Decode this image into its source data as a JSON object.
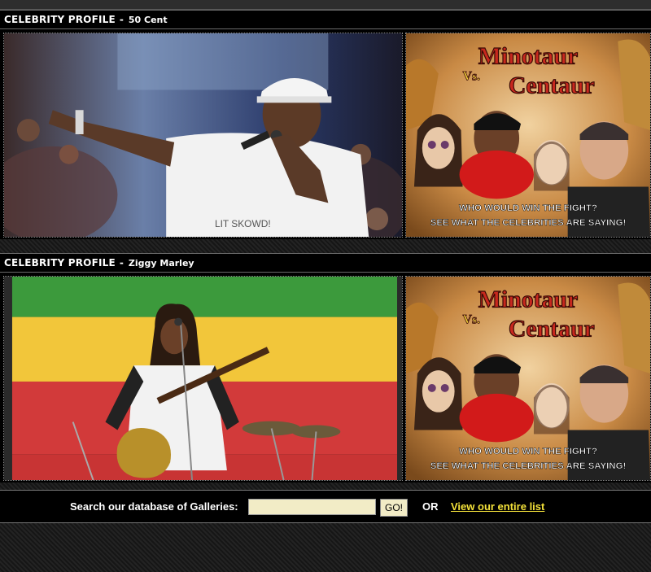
{
  "sections": [
    {
      "header": {
        "label": "CELEBRITY PROFILE",
        "separator": "-",
        "name": "50 Cent"
      },
      "photo": {
        "alt": "50 Cent"
      },
      "promo": {
        "title_line1": "Minotaur",
        "vs": "Vs.",
        "title_line2": "Centaur",
        "caption_line1": "WHO WOULD WIN THE FIGHT?",
        "caption_line2": "SEE WHAT THE CELEBRITIES ARE SAYING!"
      }
    },
    {
      "header": {
        "label": "CELEBRITY PROFILE",
        "separator": "-",
        "name": "Ziggy Marley"
      },
      "photo": {
        "alt": "Ziggy Marley"
      },
      "promo": {
        "title_line1": "Minotaur",
        "vs": "Vs.",
        "title_line2": "Centaur",
        "caption_line1": "WHO WOULD WIN THE FIGHT?",
        "caption_line2": "SEE WHAT THE CELEBRITIES ARE SAYING!"
      }
    }
  ],
  "search": {
    "label": "Search our database of Galleries:",
    "value": "",
    "button": "GO!",
    "or_text": "OR",
    "link": "View our entire list"
  },
  "colors": {
    "header_bg": "#000000",
    "link": "#f4e23a",
    "input_bg": "#f2ecc6",
    "promo_title": "#c8281e"
  }
}
